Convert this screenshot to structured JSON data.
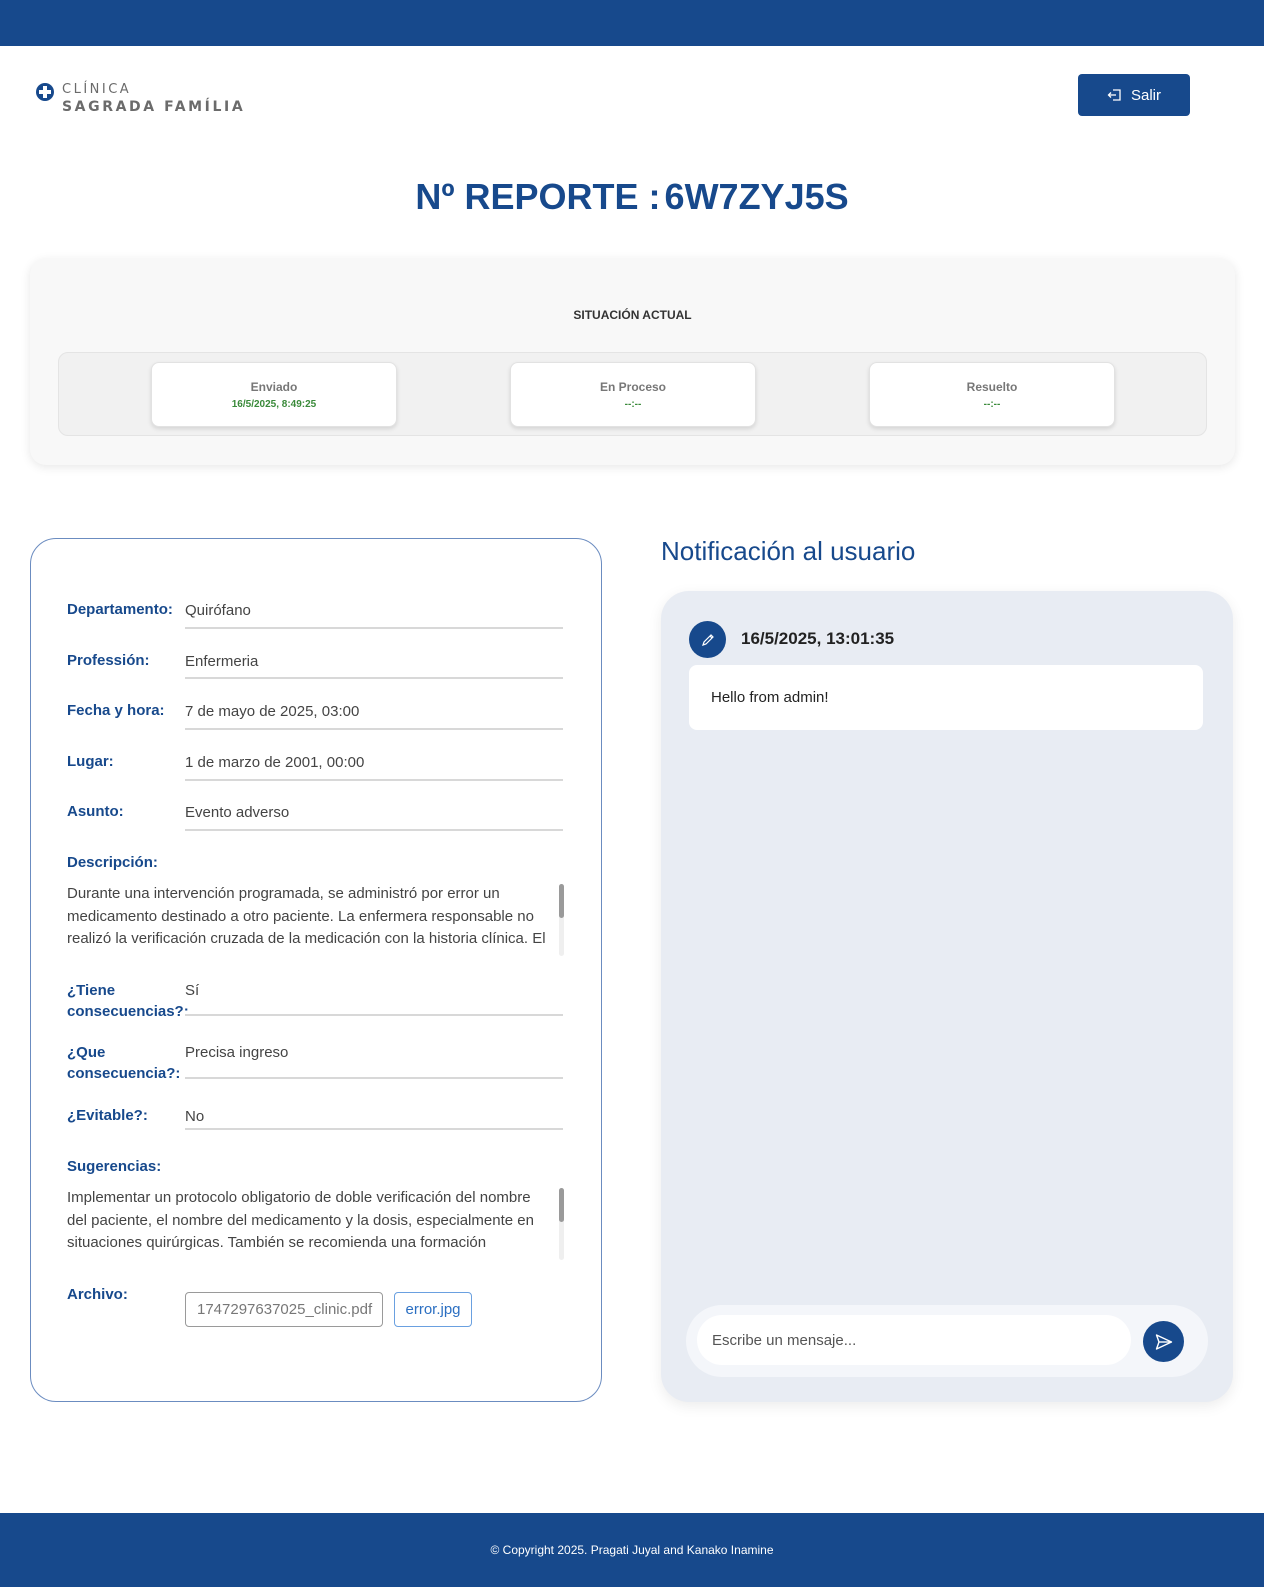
{
  "brand": {
    "line1": "CLÍNICA",
    "line2": "SAGRADA FAMÍLIA",
    "color": "#17498c"
  },
  "header": {
    "logout_label": "Salir"
  },
  "report": {
    "title_prefix": "Nº REPORTE :",
    "id": "6W7ZYJ5S"
  },
  "status": {
    "heading": "SITUACIÓN ACTUAL",
    "steps": [
      {
        "label": "Enviado",
        "date": "16/5/2025, 8:49:25"
      },
      {
        "label": "En Proceso",
        "date": "--:--"
      },
      {
        "label": "Resuelto",
        "date": "--:--"
      }
    ]
  },
  "form": {
    "departamento": {
      "label": "Departamento:",
      "value": "Quirófano"
    },
    "profesion": {
      "label": "Professión:",
      "value": "Enfermeria"
    },
    "fecha": {
      "label": "Fecha y hora:",
      "value": "7 de mayo de 2025, 03:00"
    },
    "lugar": {
      "label": "Lugar:",
      "value": "1 de marzo de 2001, 00:00"
    },
    "asunto": {
      "label": "Asunto:",
      "value": "Evento adverso"
    },
    "descripcion": {
      "label": "Descripción:",
      "value": "Durante una intervención programada, se administró por error un medicamento destinado a otro paciente. La enfermera responsable no realizó la verificación cruzada de la medicación con la historia clínica. El paciente presentó una reacción adversa leve a los 15 minutos y fue atendido de inmediato."
    },
    "consecuencias": {
      "label_line1": "¿Tiene",
      "label_line2": "consecuencias?:",
      "value": "Sí"
    },
    "que_consecuencia": {
      "label_line1": "¿Que",
      "label_line2": "consecuencia?:",
      "value": "Precisa ingreso"
    },
    "evitable": {
      "label": "¿Evitable?:",
      "value": "No"
    },
    "sugerencias": {
      "label": "Sugerencias:",
      "value": "Implementar un protocolo obligatorio de doble verificación del nombre del paciente, el nombre del medicamento y la dosis, especialmente en situaciones quirúrgicas. También se recomienda una formación adicional sobre seguridad en la administración de medicamentos al personal de enfermería."
    },
    "archivo": {
      "label": "Archivo:",
      "filename": "1747297637025_clinic.pdf",
      "link": "error.jpg"
    }
  },
  "notification": {
    "title": "Notificación al usuario",
    "messages": [
      {
        "time": "16/5/2025, 13:01:35",
        "text": "Hello from admin!"
      }
    ],
    "input_placeholder": "Escribe un mensaje..."
  },
  "footer": {
    "copyright": "© Copyright 2025. Pragati Juyal and Kanako Inamine"
  }
}
